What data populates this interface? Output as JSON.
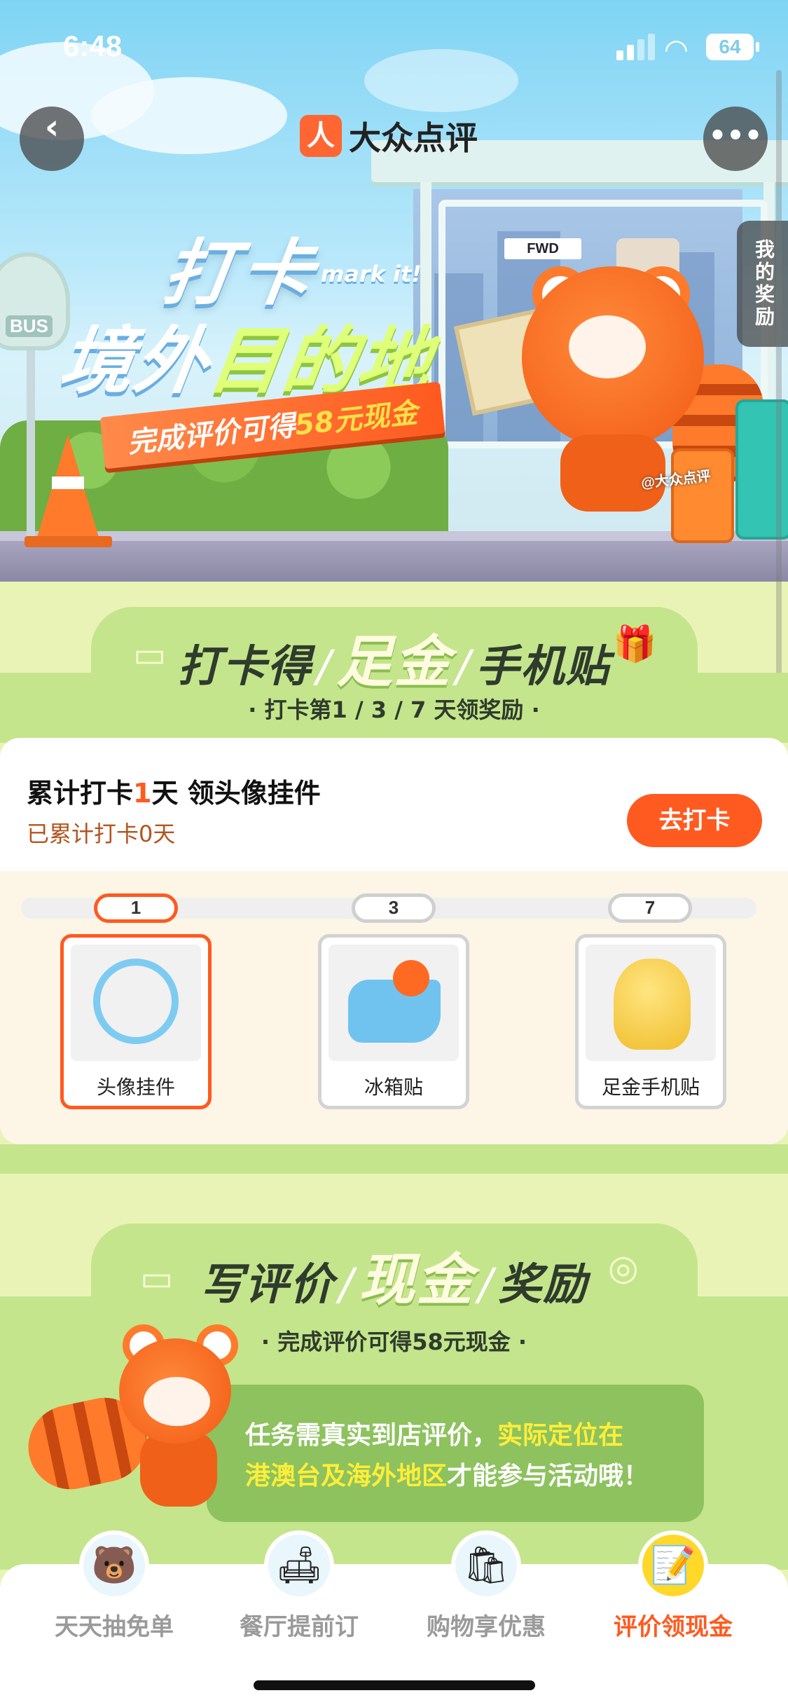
{
  "status_bar": {
    "time": "6:48",
    "battery": "64"
  },
  "header": {
    "brand": "大众点评",
    "brand_logo_glyph": "人",
    "back_icon": "chevron-left-icon",
    "more_icon": "ellipsis-icon",
    "reward_tab": "我的奖励"
  },
  "hero": {
    "line1": "打卡",
    "tag": "mark it!",
    "line2_a": "境外",
    "line2_b": "目的地",
    "banner_a": "完成评价可得",
    "banner_b": "58元现金",
    "bus_sign": "BUS",
    "ad_logo": "FWD",
    "watermark": "@大众点评"
  },
  "checkin": {
    "title_a": "打卡得",
    "title_b": "足金",
    "title_c": "手机贴",
    "subtitle": "· 打卡第1 / 3 / 7 天领奖励 ·",
    "card_title_a": "累计打卡",
    "card_title_n": "1",
    "card_title_b": "天 领头像挂件",
    "card_sub": "已累计打卡0天",
    "button": "去打卡",
    "milestones": [
      {
        "day": "1",
        "label": "头像挂件",
        "active": true
      },
      {
        "day": "3",
        "label": "冰箱贴",
        "active": false
      },
      {
        "day": "7",
        "label": "足金手机贴",
        "active": false
      }
    ]
  },
  "review": {
    "title_a": "写评价",
    "title_b": "现金",
    "title_c": "奖励",
    "subtitle": "· 完成评价可得58元现金 ·",
    "notice_a": "任务需真实到店评价，",
    "notice_b": "实际定位在",
    "notice_c": "港澳台及海外地区",
    "notice_d": "才能参与活动哦！"
  },
  "bottom_nav": [
    {
      "label": "天天抽免单",
      "icon": "bear-icon",
      "active": false
    },
    {
      "label": "餐厅提前订",
      "icon": "sofa-icon",
      "active": false
    },
    {
      "label": "购物享优惠",
      "icon": "shopping-bag-icon",
      "active": false
    },
    {
      "label": "评价领现金",
      "icon": "notepad-icon",
      "active": true
    }
  ],
  "colors": {
    "accent": "#ff5a1f",
    "section_green": "#c4e58c",
    "page_bg": "#eaf3b6",
    "notice_green": "#8dc25e"
  }
}
